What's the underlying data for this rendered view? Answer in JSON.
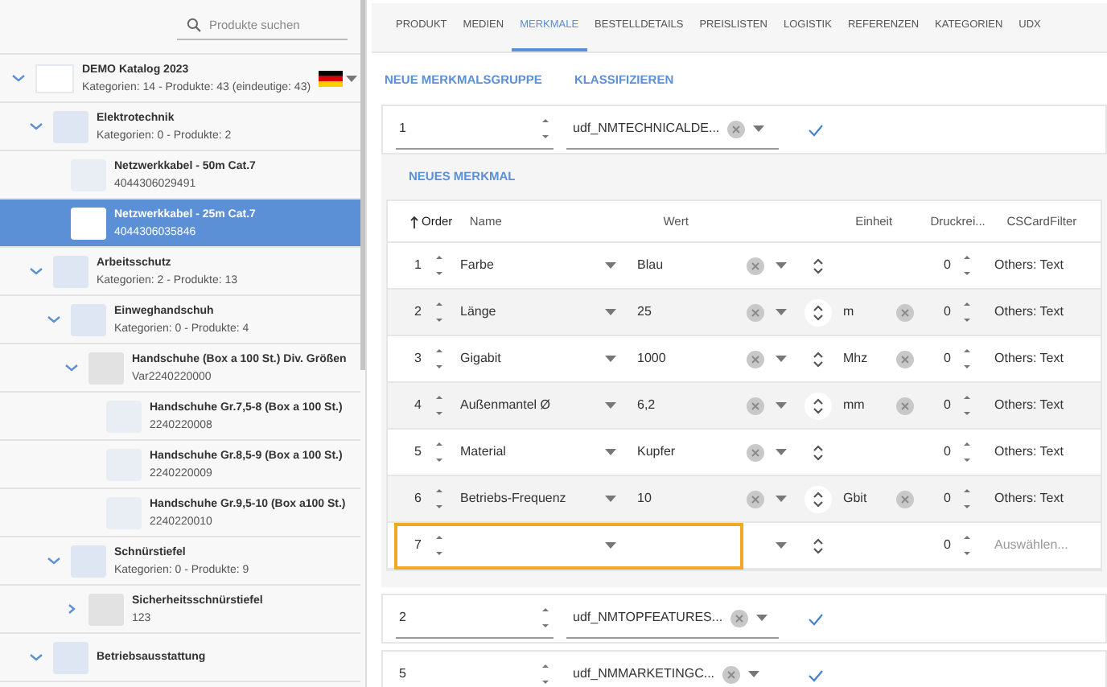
{
  "search": {
    "placeholder": "Produkte suchen"
  },
  "tree": [
    {
      "title": "DEMO Katalog 2023",
      "subtitle": "Kategorien: 14 - Produkte: 43 (eindeutige: 43)",
      "kind": "catalog",
      "expanded": true,
      "selected": false,
      "children": [
        {
          "title": "Elektrotechnik",
          "subtitle": "Kategorien: 0 - Produkte: 2",
          "kind": "category",
          "expanded": true,
          "selected": false,
          "children": [
            {
              "title": "Netzwerkkabel - 50m Cat.7",
              "subtitle": "4044306029491",
              "kind": "product",
              "selected": false
            },
            {
              "title": "Netzwerkkabel - 25m Cat.7",
              "subtitle": "4044306035846",
              "kind": "product",
              "selected": true
            }
          ]
        },
        {
          "title": "Arbeitsschutz",
          "subtitle": "Kategorien: 2 - Produkte: 13",
          "kind": "category",
          "expanded": true,
          "selected": false,
          "children": [
            {
              "title": "Einweghandschuh",
              "subtitle": "Kategorien: 0 - Produkte: 4",
              "kind": "category",
              "expanded": true,
              "selected": false,
              "children": [
                {
                  "title": "Handschuhe (Box a 100 St.) Div. Größen",
                  "subtitle": "Var2240220000",
                  "kind": "variant",
                  "expanded": true,
                  "selected": false,
                  "children": [
                    {
                      "title": "Handschuhe Gr.7,5-8 (Box a 100 St.)",
                      "subtitle": "2240220008",
                      "kind": "product",
                      "selected": false
                    },
                    {
                      "title": "Handschuhe Gr.8,5-9 (Box a 100 St.)",
                      "subtitle": "2240220009",
                      "kind": "product",
                      "selected": false
                    },
                    {
                      "title": "Handschuhe Gr.9,5-10 (Box a100 St.)",
                      "subtitle": "2240220010",
                      "kind": "product",
                      "selected": false
                    }
                  ]
                }
              ]
            },
            {
              "title": "Schnürstiefel",
              "subtitle": "Kategorien: 0 - Produkte: 9",
              "kind": "category",
              "expanded": true,
              "selected": false,
              "children": [
                {
                  "title": "Sicherheitsschnürstiefel",
                  "subtitle": "123",
                  "kind": "variant",
                  "expanded": false,
                  "selected": false
                }
              ]
            }
          ]
        },
        {
          "title": "Betriebsausstattung",
          "kind": "category",
          "expanded": true,
          "selected": false
        }
      ]
    }
  ],
  "tabs": [
    {
      "label": "PRODUKT",
      "selected": false
    },
    {
      "label": "MEDIEN",
      "selected": false
    },
    {
      "label": "MERKMALE",
      "selected": true
    },
    {
      "label": "BESTELLDETAILS",
      "selected": false
    },
    {
      "label": "PREISLISTEN",
      "selected": false
    },
    {
      "label": "LOGISTIK",
      "selected": false
    },
    {
      "label": "REFERENZEN",
      "selected": false
    },
    {
      "label": "KATEGORIEN",
      "selected": false
    },
    {
      "label": "UDX",
      "selected": false
    }
  ],
  "actions": [
    "NEUE MERKMALSGRUPPE",
    "KLASSIFIZIEREN"
  ],
  "groups": [
    {
      "order": "1",
      "name": "udf_NMTECHNICALDE...",
      "add_button": "NEUES MERKMAL",
      "table": {
        "columns": [
          {
            "label": "Order",
            "sorted": true
          },
          {
            "label": "Name",
            "sorted": false
          },
          {
            "label": "Wert",
            "sorted": false
          },
          {
            "label": "Einheit",
            "sorted": false
          },
          {
            "label": "Druckrei...",
            "sorted": false
          },
          {
            "label": "CSCardFilter",
            "sorted": false
          }
        ],
        "rows": [
          {
            "order": "1",
            "name": "Farbe",
            "value": "Blau",
            "print_order": "0",
            "filter": "Others: Text",
            "focused": false
          },
          {
            "order": "2",
            "name": "Länge",
            "value": "25",
            "unit": "m",
            "print_order": "0",
            "filter": "Others: Text",
            "focused": false
          },
          {
            "order": "3",
            "name": "Gigabit",
            "value": "1000",
            "unit": "Mhz",
            "print_order": "0",
            "filter": "Others: Text",
            "focused": false
          },
          {
            "order": "4",
            "name": "Außenmantel Ø",
            "value": "6,2",
            "unit": "mm",
            "print_order": "0",
            "filter": "Others: Text",
            "focused": false
          },
          {
            "order": "5",
            "name": "Material",
            "value": "Kupfer",
            "print_order": "0",
            "filter": "Others: Text",
            "focused": false
          },
          {
            "order": "6",
            "name": "Betriebs-Frequenz",
            "value": "10",
            "unit": "Gbit",
            "print_order": "0",
            "filter": "Others: Text",
            "focused": false
          },
          {
            "order": "7",
            "print_order": "0",
            "filter_placeholder": "Auswählen...",
            "focused": true
          }
        ]
      }
    },
    {
      "order": "2",
      "name": "udf_NMTOPFEATURES..."
    },
    {
      "order": "5",
      "name": "udf_NMMARKETINGC..."
    }
  ]
}
